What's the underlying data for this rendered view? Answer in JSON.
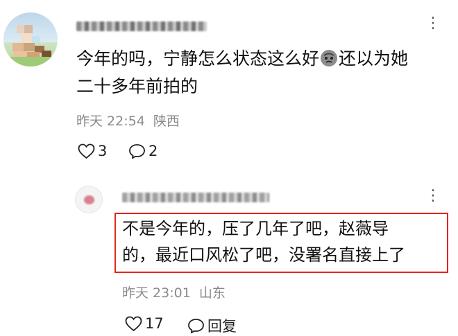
{
  "comment": {
    "text_line1_before_emoji": "今年的吗，宁静怎么状态这么好",
    "text_line1_after_emoji": "还以为她",
    "text_line2": "二十多年前拍的",
    "emoji": "face-icon",
    "time": "昨天 22:54",
    "location": "陕西",
    "likes": "3",
    "replies": "2"
  },
  "reply": {
    "line1": "不是今年的，压了几年了吧，赵薇导",
    "line2": "的，最近口风松了吧，没署名直接上了",
    "time": "昨天 23:01",
    "location": "山东",
    "likes": "17",
    "reply_label": "回复"
  },
  "colors": {
    "highlight": "#e1251b",
    "meta_gray": "#8a8a8a",
    "text": "#111111"
  }
}
